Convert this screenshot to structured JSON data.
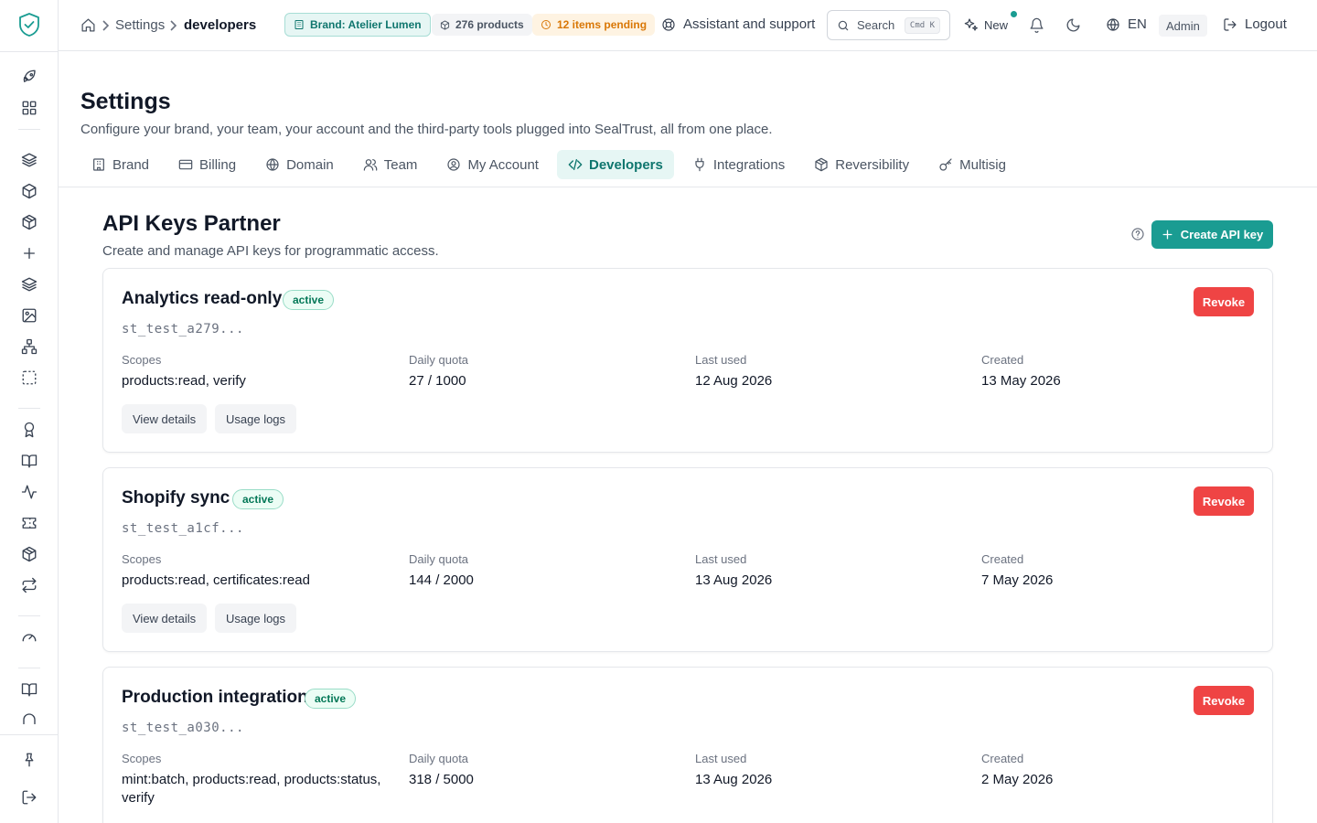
{
  "breadcrumb": {
    "section": "Settings",
    "current": "developers"
  },
  "topbar": {
    "brand_pill": "Brand: Atelier Lumen",
    "products_pill": "276 products",
    "pending_pill": "12 items pending",
    "assistant": "Assistant and support",
    "search_label": "Search",
    "search_kbd": "Cmd K",
    "new_label": "New",
    "language": "EN",
    "role": "Admin",
    "logout": "Logout"
  },
  "page": {
    "title": "Settings",
    "description": "Configure your brand, your team, your account and the third-party tools plugged into SealTrust, all from one place."
  },
  "tabs": [
    {
      "label": "Brand",
      "icon": "building-icon"
    },
    {
      "label": "Billing",
      "icon": "credit-card-icon"
    },
    {
      "label": "Domain",
      "icon": "globe-icon"
    },
    {
      "label": "Team",
      "icon": "users-icon"
    },
    {
      "label": "My Account",
      "icon": "user-circle-icon"
    },
    {
      "label": "Developers",
      "icon": "code-icon",
      "active": true
    },
    {
      "label": "Integrations",
      "icon": "plug-icon"
    },
    {
      "label": "Reversibility",
      "icon": "box-icon"
    },
    {
      "label": "Multisig",
      "icon": "key-icon"
    }
  ],
  "section": {
    "title": "API Keys Partner",
    "description": "Create and manage API keys for programmatic access.",
    "create_button": "Create API key"
  },
  "field_labels": {
    "scopes": "Scopes",
    "quota": "Daily quota",
    "last_used": "Last used",
    "created": "Created"
  },
  "actions": {
    "revoke": "Revoke",
    "view_details": "View details",
    "usage_logs": "Usage logs"
  },
  "api_keys": [
    {
      "name": "Analytics read-only",
      "status": "active",
      "key": "st_test_a279...",
      "scopes": "products:read, verify",
      "quota": "27 / 1000",
      "last_used": "12 Aug 2026",
      "created": "13 May 2026"
    },
    {
      "name": "Shopify sync",
      "status": "active",
      "key": "st_test_a1cf...",
      "scopes": "products:read, certificates:read",
      "quota": "144 / 2000",
      "last_used": "13 Aug 2026",
      "created": "7 May 2026"
    },
    {
      "name": "Production integration",
      "status": "active",
      "key": "st_test_a030...",
      "scopes": "mint:batch, products:read, products:status, verify",
      "quota": "318 / 5000",
      "last_used": "13 Aug 2026",
      "created": "2 May 2026"
    }
  ],
  "colors": {
    "accent": "#1a9c92",
    "danger": "#ef4444",
    "pending": "#d97706"
  }
}
